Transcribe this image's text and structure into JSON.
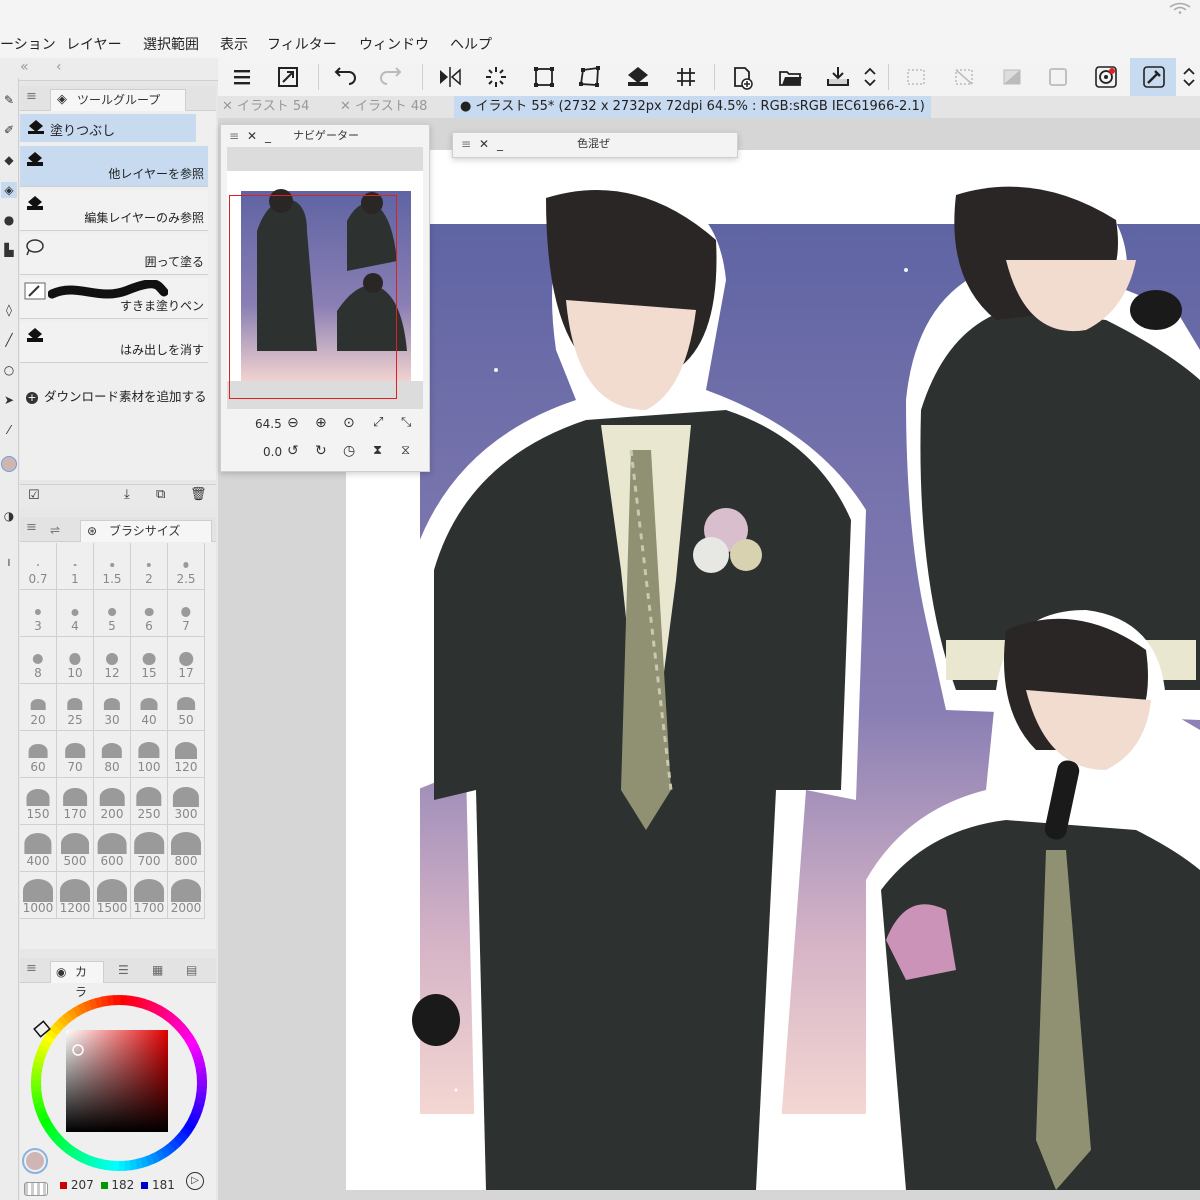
{
  "menu": {
    "items": [
      "ーション",
      "レイヤー",
      "選択範囲",
      "表示",
      "フィルター",
      "ウィンドウ",
      "ヘルプ"
    ]
  },
  "subtool_panel": {
    "group_tab": "ツールグループ",
    "head_label": "塗りつぶし",
    "items": [
      "他レイヤーを参照",
      "編集レイヤーのみ参照",
      "囲って塗る",
      "すきま塗りペン",
      "はみ出しを消す"
    ],
    "add_material": "ダウンロード素材を追加する"
  },
  "brush_panel": {
    "tab_label": "ブラシサイズ",
    "sizes": [
      "0.7",
      "1",
      "1.5",
      "2",
      "2.5",
      "3",
      "4",
      "5",
      "6",
      "7",
      "8",
      "10",
      "12",
      "15",
      "17",
      "20",
      "25",
      "30",
      "40",
      "50",
      "60",
      "70",
      "80",
      "100",
      "120",
      "150",
      "170",
      "200",
      "250",
      "300",
      "400",
      "500",
      "600",
      "700",
      "800",
      "1000",
      "1200",
      "1500",
      "1700",
      "2000"
    ]
  },
  "color_panel": {
    "tab_label": "カラ",
    "r": "207",
    "g": "182",
    "b": "181",
    "current_color": "#cfb6b5",
    "accent_colors": {
      "r": "#cc0000",
      "g": "#009900",
      "b": "#0000cc"
    }
  },
  "doc_tabs": [
    {
      "label": "イラスト 54"
    },
    {
      "label": "イラスト 48"
    },
    {
      "label": "イラスト 55* (2732 x 2732px 72dpi 64.5% : RGB:sRGB IEC61966-2.1)"
    }
  ],
  "navigator": {
    "title": "ナビゲーター",
    "zoom": "64.5",
    "rotation": "0.0"
  },
  "color_mix": {
    "title": "色混ぜ"
  },
  "toolbar": {
    "icons": [
      "menu-icon",
      "resize-icon",
      "undo-icon",
      "redo-icon",
      "flip-horizontal-icon",
      "loading-icon",
      "transform-icon",
      "free-transform-icon",
      "fill-icon",
      "grid-icon",
      "new-canvas-icon",
      "open-folder-icon",
      "export-icon",
      "chevron-updown-icon",
      "selection-icon",
      "clear-selection-icon",
      "gradient-icon",
      "frame-icon",
      "ring-icon",
      "eyedropper-icon",
      "chevron-updown-icon-2"
    ]
  },
  "colors": {
    "selection_blue": "#c7daf0",
    "canvas_bg": "#6a6ea8"
  }
}
